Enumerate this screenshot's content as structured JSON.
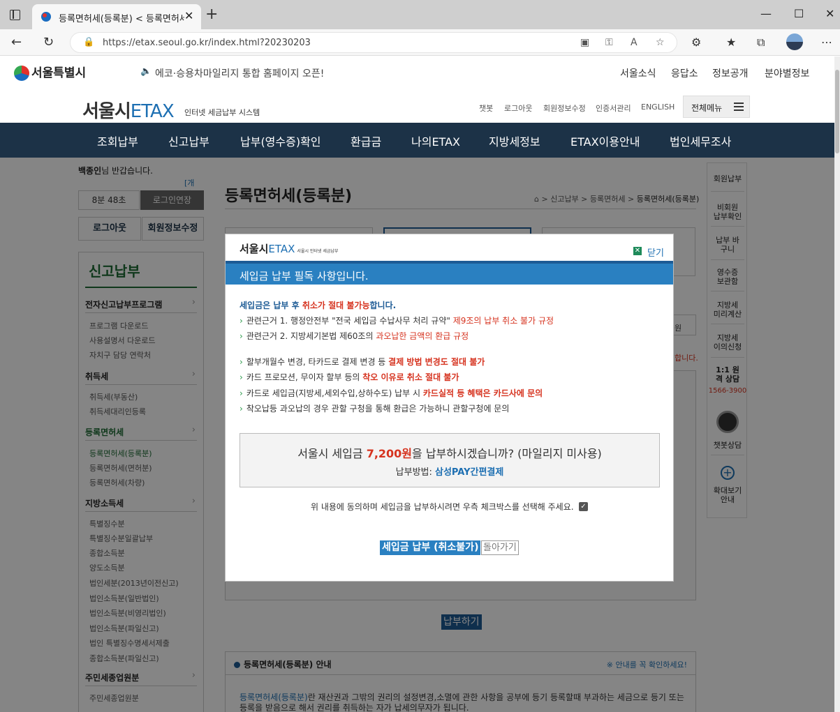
{
  "browser": {
    "tab_title": "등록면허세(등록분) < 등록면허세",
    "url": "https://etax.seoul.go.kr/index.html?20230203"
  },
  "site_top": {
    "logo": "서울특별시",
    "notice": "에코·승용차마일리지 통합 홈페이지 오픈!",
    "links": [
      "서울소식",
      "응답소",
      "정보공개",
      "분야별정보"
    ]
  },
  "etax_header": {
    "logo_main": "서울시",
    "logo_etax": "ETAX",
    "logo_sub": "인터넷 세금납부 시스템",
    "util_links": [
      "챗봇",
      "로그아웃",
      "회원정보수정",
      "인증서관리",
      "ENGLISH"
    ],
    "all_menu": "전체메뉴"
  },
  "gnb": [
    "조회납부",
    "신고납부",
    "납부(영수증)확인",
    "환급금",
    "나의ETAX",
    "지방세정보",
    "ETAX이용안내",
    "법인세무조사"
  ],
  "sidebar": {
    "user": "백종인",
    "greeting": "님 반갑습니다.",
    "member_type": "[개인]",
    "timer": "8분 48초",
    "extend": "로그인연장",
    "logout": "로그아웃",
    "edit_info": "회원정보수정",
    "title": "신고납부",
    "categories": [
      {
        "label": "전자신고납부프로그램",
        "subs": [
          "프로그램 다운로드",
          "사용설명서 다운로드",
          "자치구 담당 연락처"
        ]
      },
      {
        "label": "취득세",
        "subs": [
          "취득세(부동산)",
          "취득세대리인등록"
        ]
      },
      {
        "label": "등록면허세",
        "subs": [
          "등록면허세(등록분)",
          "등록면허세(면허분)",
          "등록면허세(차량)"
        ]
      },
      {
        "label": "지방소득세",
        "subs": [
          "특별징수분",
          "특별징수분일괄납부",
          "종합소득분",
          "양도소득분",
          "법인세분(2013년이전신고)",
          "법인소득분(일반법인)",
          "법인소득분(비영리법인)",
          "법인소득분(파일신고)",
          "법인 특별징수명세서제출",
          "종합소득분(파일신고)"
        ]
      },
      {
        "label": "주민세종업원분",
        "subs": [
          "주민세종업원분"
        ]
      }
    ]
  },
  "content": {
    "title": "등록면허세(등록분)",
    "breadcrumb": [
      "신고납부",
      "등록면허세"
    ],
    "breadcrumb_current": "등록면허세(등록분)",
    "bg_fragment_1": "원",
    "bg_fragment_2": "합니다.",
    "pay_button": "납부하기",
    "info_title": "등록면허세(등록분) 안내",
    "info_note": "※ 안내를 꼭 확인하세요!",
    "info_term": "등록면허세(등록분)",
    "info_body": "란 재산권과 그밖의 권리의 설정변경,소멸에 관한 사항을 공부에 등기 등록할때 부과하는 세금으로 등기 또는 등록을 받음으로 해서 권리를 취득하는 자가 납세의무자가 됩니다."
  },
  "quick_menu": {
    "items": [
      "회원납부",
      "비회원 납부확인",
      "납부 바구니",
      "영수증 보관함",
      "지방세 미리계산",
      "지방세 이의신청",
      "1:1 원격 상담"
    ],
    "phone": "1566-3900",
    "chatbot": "챗봇상담",
    "zoom": "확대보기 안내"
  },
  "modal": {
    "logo_main": "서울시",
    "logo_etax": "ETAX",
    "logo_sub": "서울시 인터넷 세금납부",
    "close": "닫기",
    "banner": "세입금 납부 필독 사항입니다.",
    "lead_a": "세입금은 납부 후 ",
    "lead_b": "취소가 절대 불가능",
    "lead_c": "합니다.",
    "r1_a": "관련근거 1. 행정안전부 \"전국 세입금 수납사무 처리 규약\" ",
    "r1_b": "제9조의 납부 취소 불가 규정",
    "r2_a": "관련근거 2. 지방세기본법 제60조의 ",
    "r2_b": "과오납한 금액의 환급 규정",
    "r3_a": "할부개월수 변경, 타카드로 결제 변경 등 ",
    "r3_b": "결제 방법 변경도 절대 불가",
    "r4_a": "카드 프로모션, 무이자 할부 등의 ",
    "r4_b": "착오 이유로 취소 절대 불가",
    "r5_a": "카드로 세입금(지방세,세외수입,상하수도) 납부 시 ",
    "r5_b": "카드실적 등 혜택은 카드사에 문의",
    "r6": "착오납등 과오납의 경우 관할 구청을 통해 환급은 가능하니 관할구청에 문의",
    "question_a": "서울시 세입금 ",
    "amount": "7,200원",
    "question_b": "을 납부하시겠습니까? (마일리지 미사용)",
    "method_label": "납부방법: ",
    "method": "삼성PAY간편결제",
    "agree": "위 내용에 동의하며 세입금을 납부하시려면 우측 체크박스를 선택해 주세요.",
    "checked": true,
    "confirm": "세입금 납부 (취소불가)",
    "back": "돌아가기"
  }
}
